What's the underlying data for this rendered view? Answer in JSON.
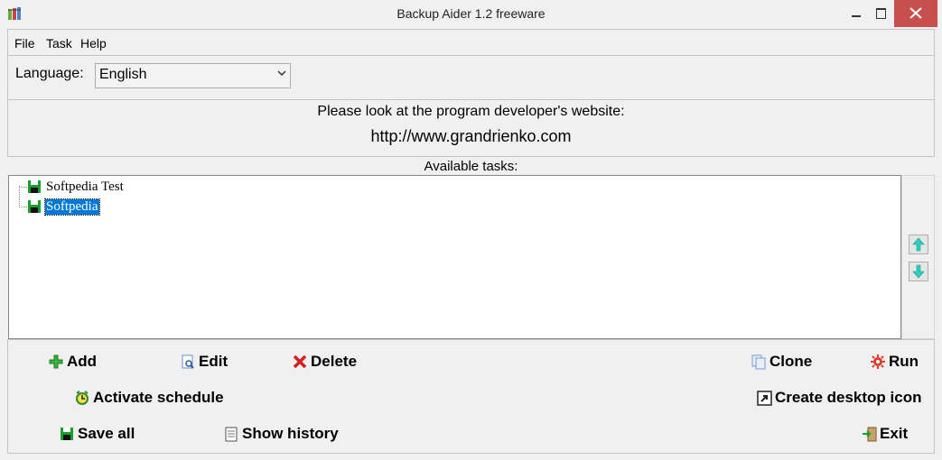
{
  "window": {
    "title": "Backup Aider 1.2 freeware"
  },
  "menu": {
    "file": "File",
    "task": "Task",
    "help": "Help"
  },
  "language": {
    "label": "Language:",
    "selected": "English"
  },
  "info": {
    "line": "Please look at the program developer's website:",
    "url": "http://www.grandrienko.com"
  },
  "tasks": {
    "label": "Available tasks:",
    "items": [
      "Softpedia Test",
      "Softpedia"
    ],
    "selected_index": 1
  },
  "actions": {
    "add": "Add",
    "edit": "Edit",
    "delete": "Delete",
    "clone": "Clone",
    "run": "Run",
    "activate_schedule": "Activate schedule",
    "create_desktop_icon": "Create desktop icon",
    "save_all": "Save all",
    "show_history": "Show history",
    "exit": "Exit"
  },
  "colors": {
    "selection": "#0078d7",
    "close_button": "#c7504e",
    "accent_green": "#2e9e2e"
  }
}
